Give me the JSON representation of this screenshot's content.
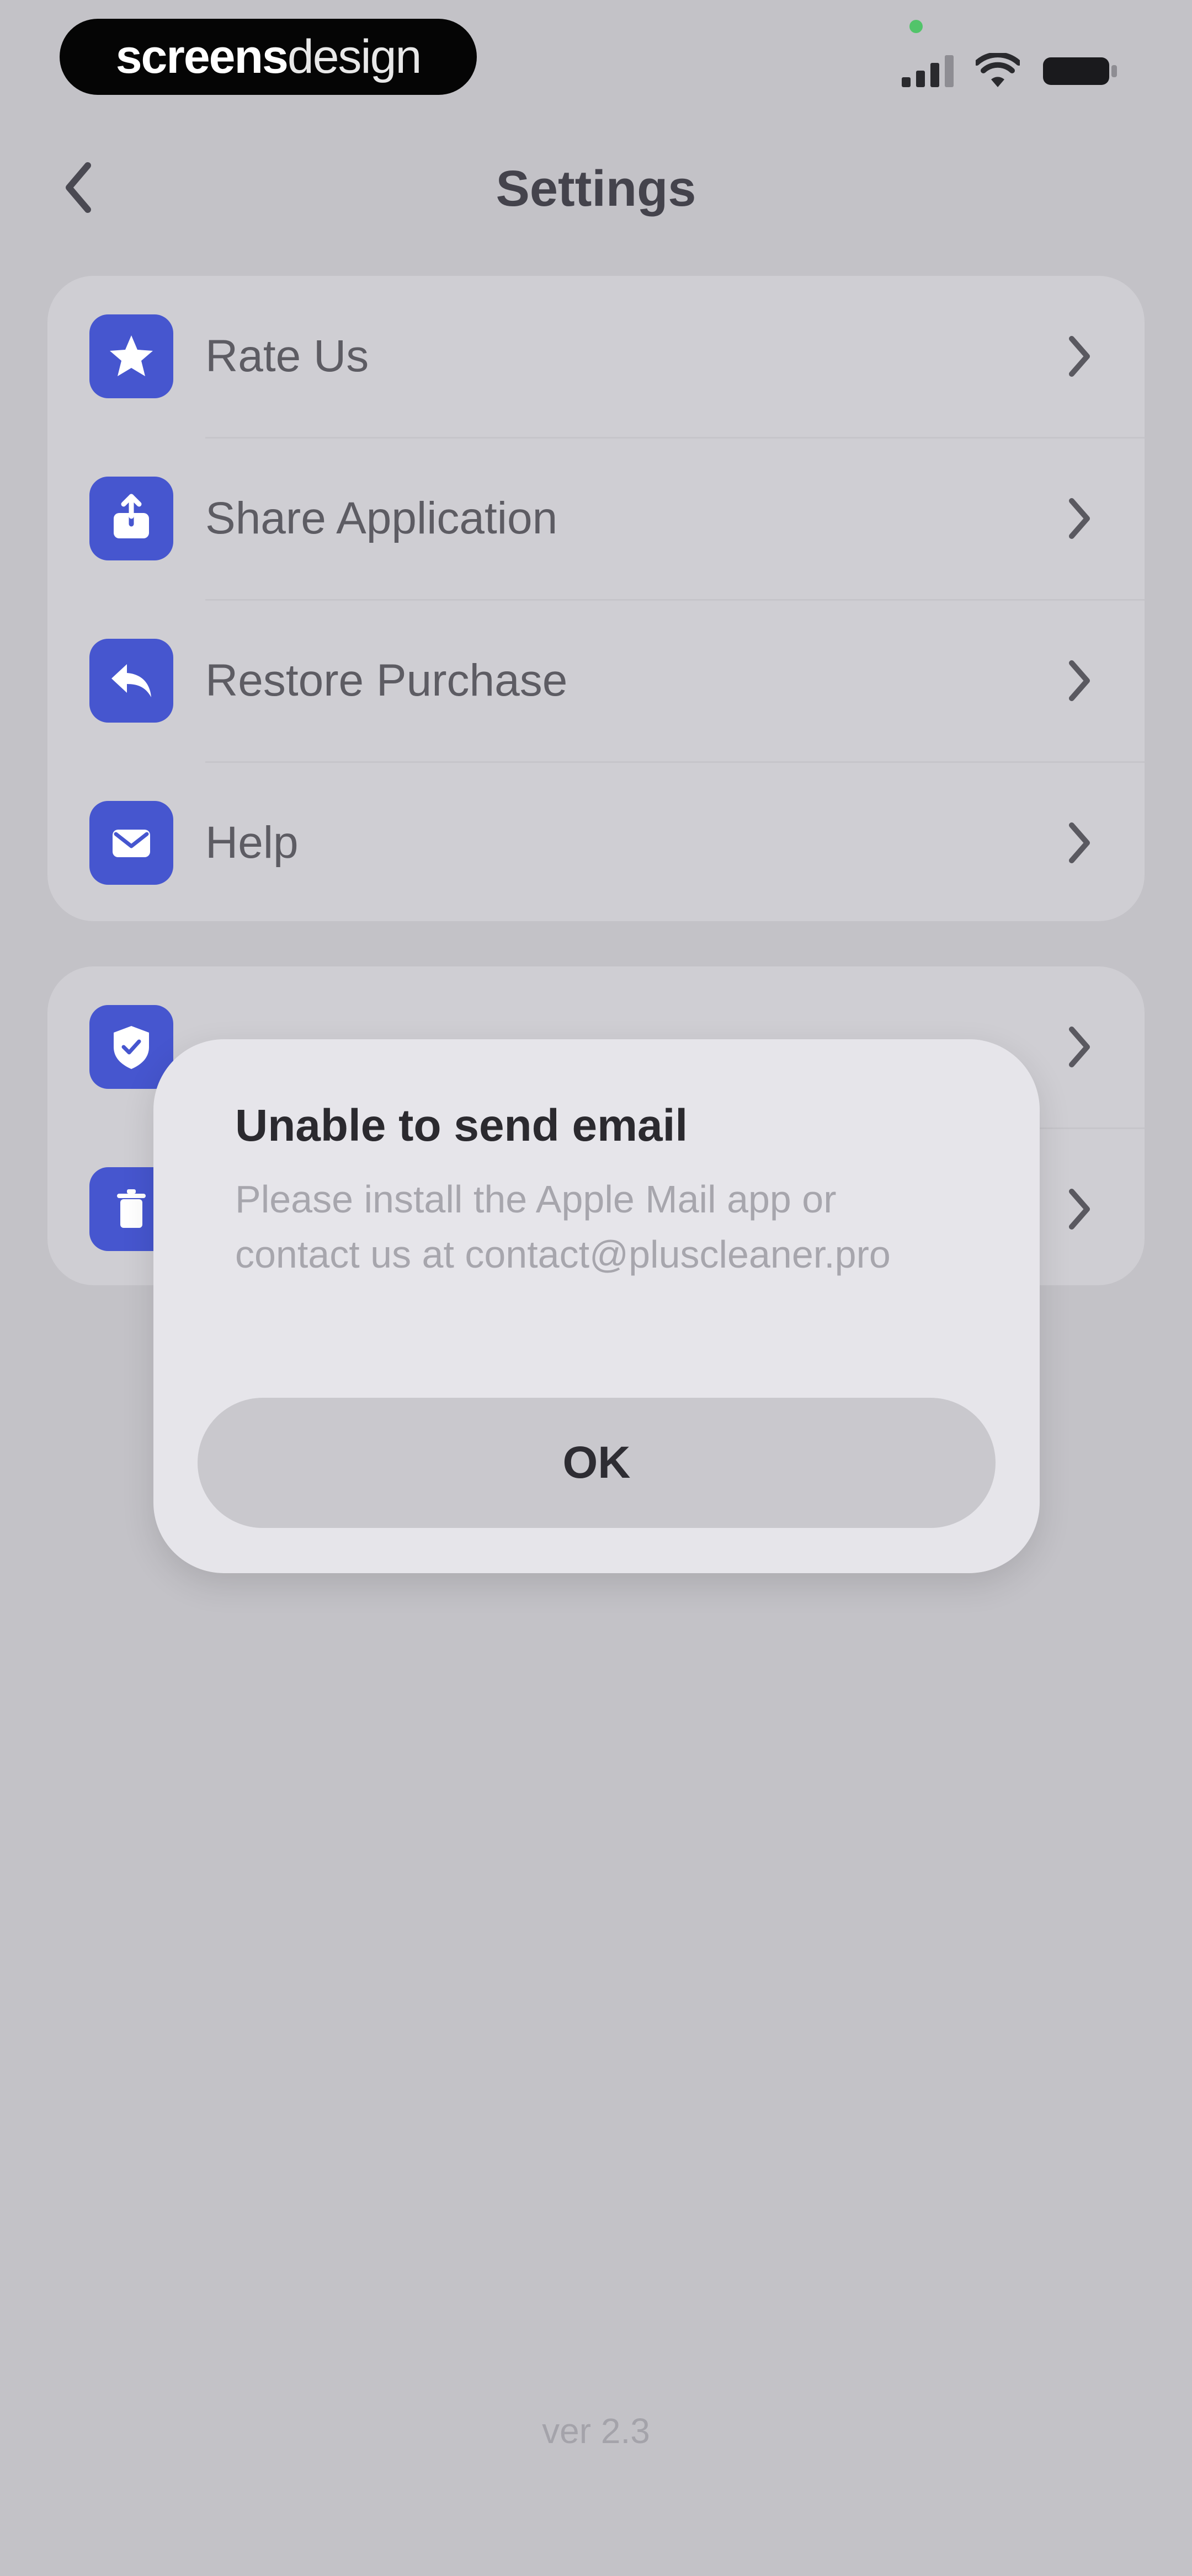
{
  "status_bar": {
    "brand_bold": "screens",
    "brand_light": "design"
  },
  "nav": {
    "title": "Settings"
  },
  "settings": {
    "group1": [
      {
        "label": "Rate Us",
        "icon": "star-icon"
      },
      {
        "label": "Share Application",
        "icon": "share-icon"
      },
      {
        "label": "Restore Purchase",
        "icon": "restore-icon"
      },
      {
        "label": "Help",
        "icon": "mail-icon"
      }
    ],
    "group2": [
      {
        "label": "",
        "icon": "shield-icon"
      },
      {
        "label": "",
        "icon": "trash-icon"
      }
    ]
  },
  "dialog": {
    "title": "Unable to send email",
    "message": "Please install the Apple Mail app or contact us at contact@pluscleaner.pro",
    "ok_label": "OK"
  },
  "footer": {
    "version": "ver 2.3"
  },
  "colors": {
    "accent": "#4656cf",
    "background": "#c3c2c7",
    "card": "#cfced3",
    "dialog": "#e6e5ea"
  }
}
